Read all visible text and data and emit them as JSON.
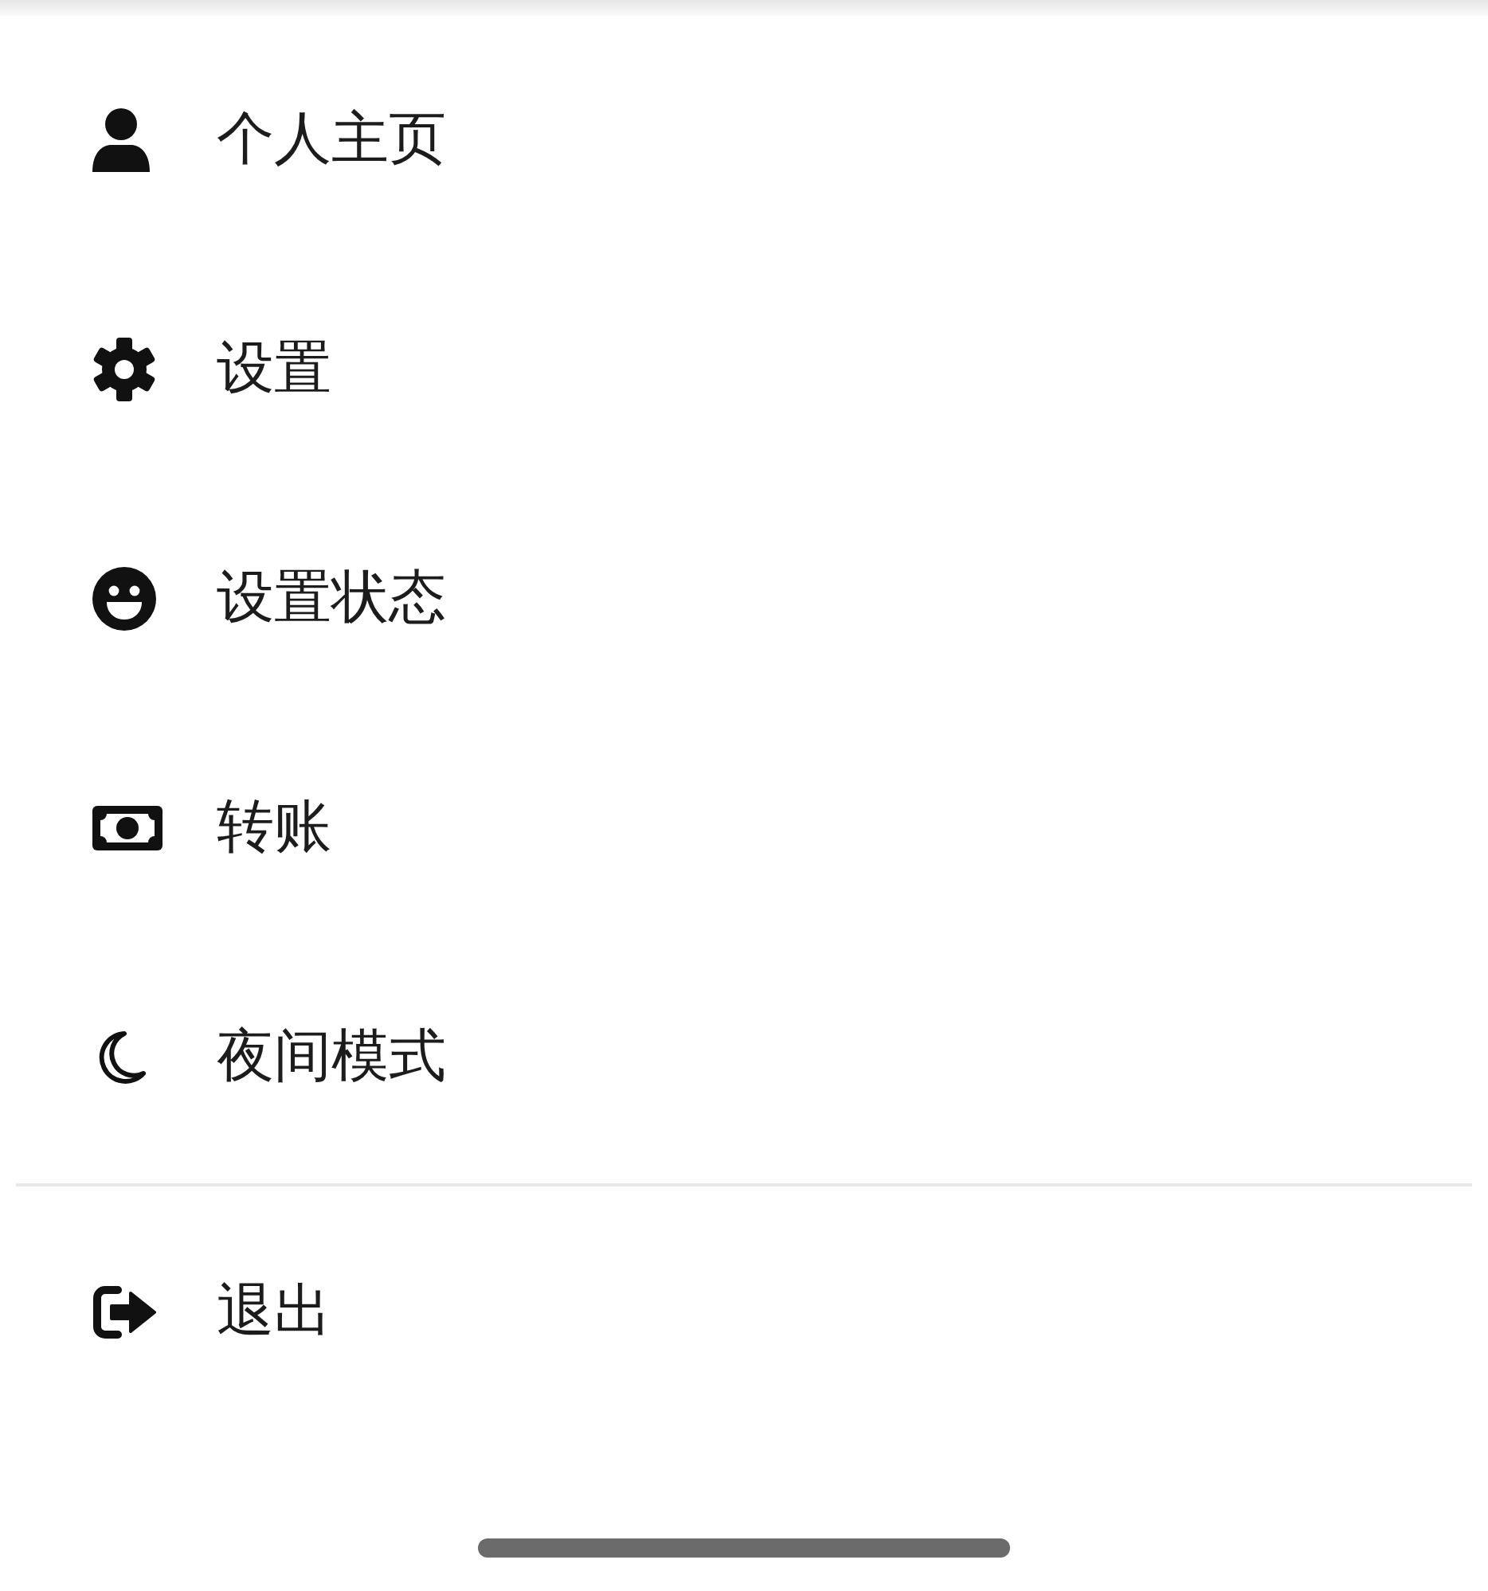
{
  "menu": [
    {
      "label": "个人主页"
    },
    {
      "label": "设置"
    },
    {
      "label": "设置状态"
    },
    {
      "label": "转账"
    },
    {
      "label": "夜间模式"
    }
  ],
  "footer_menu": [
    {
      "label": "退出"
    }
  ]
}
